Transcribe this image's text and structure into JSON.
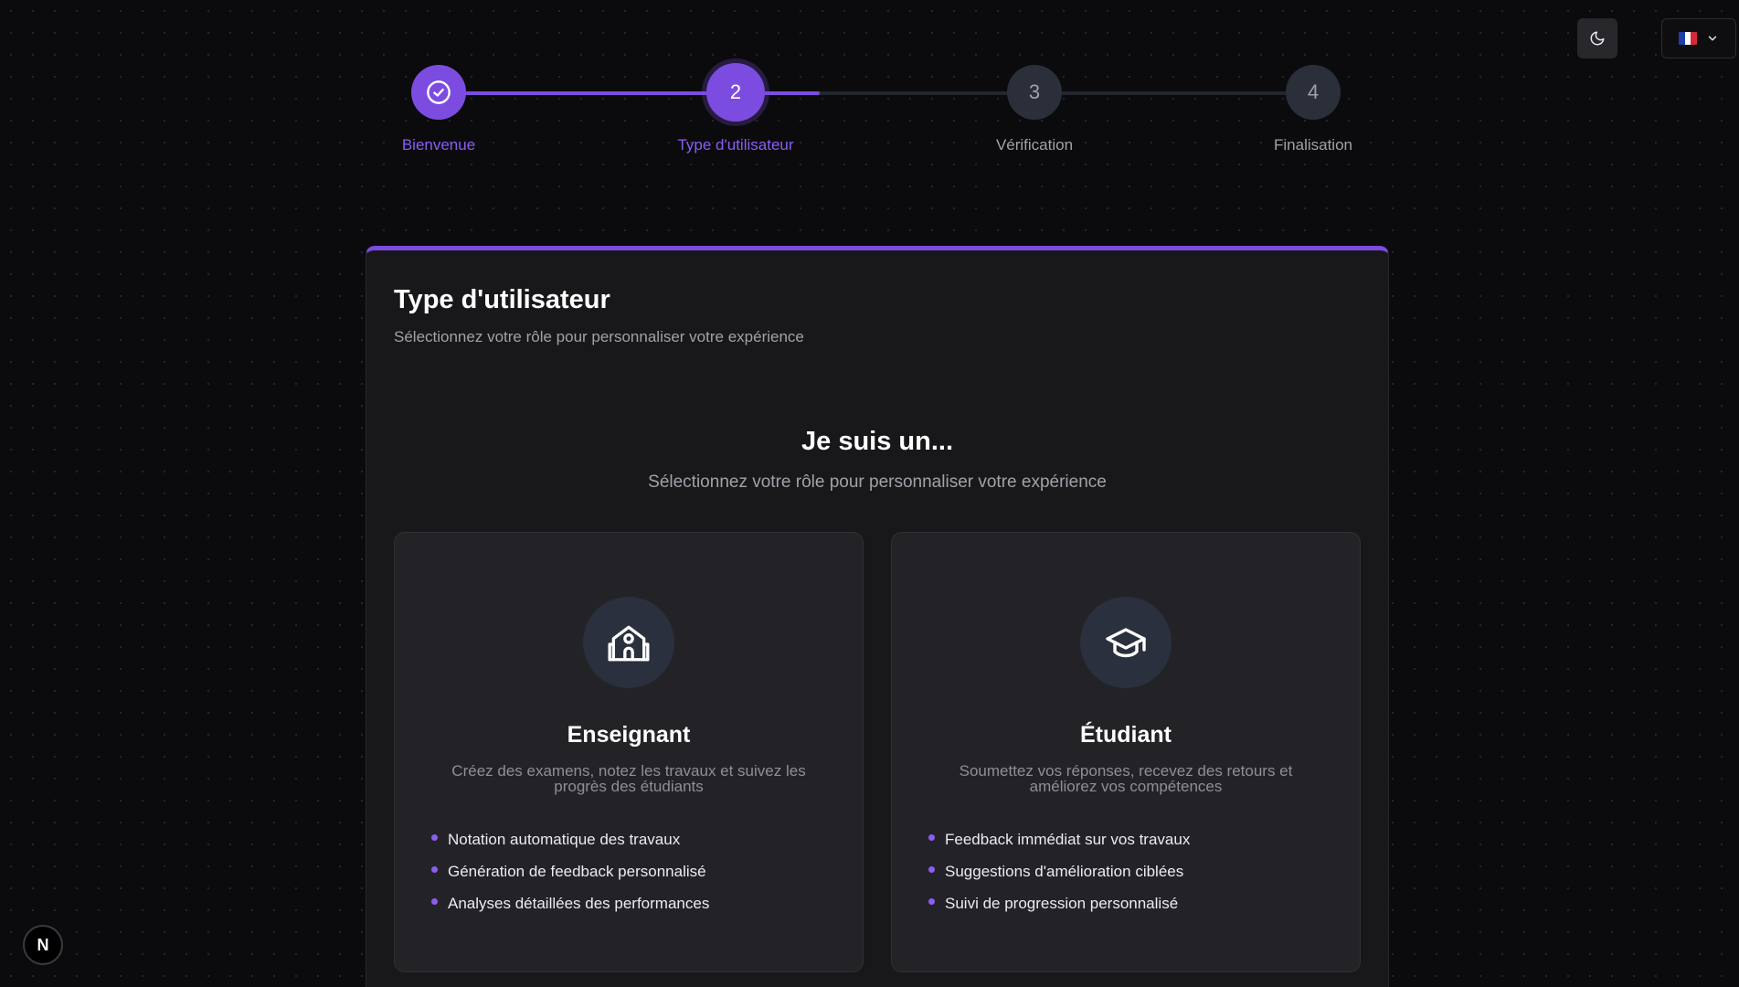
{
  "colors": {
    "accent": "#7c4ce0",
    "accent_text": "#8b5cf6",
    "inactive_step": "#2a2f3a",
    "card_bg": "#18181b"
  },
  "header": {
    "theme_toggle_icon": "moon-icon",
    "language": {
      "flag": "flag-fr-icon",
      "dropdown_icon": "chevron-down-icon"
    }
  },
  "stepper": {
    "steps": [
      {
        "label": "Bienvenue",
        "number": "",
        "state": "completed",
        "icon": "check-circle-icon"
      },
      {
        "label": "Type d'utilisateur",
        "number": "2",
        "state": "active"
      },
      {
        "label": "Vérification",
        "number": "3",
        "state": "upcoming"
      },
      {
        "label": "Finalisation",
        "number": "4",
        "state": "upcoming"
      }
    ]
  },
  "card": {
    "title": "Type d'utilisateur",
    "subtitle": "Sélectionnez votre rôle pour personnaliser votre expérience",
    "section_title": "Je suis un...",
    "section_subtitle": "Sélectionnez votre rôle pour personnaliser votre expérience",
    "roles": [
      {
        "icon": "school-icon",
        "name": "Enseignant",
        "description": "Créez des examens, notez les travaux et suivez les progrès des étudiants",
        "features": [
          "Notation automatique des travaux",
          "Génération de feedback personnalisé",
          "Analyses détaillées des performances"
        ]
      },
      {
        "icon": "graduation-cap-icon",
        "name": "Étudiant",
        "description": "Soumettez vos réponses, recevez des retours et améliorez vos compétences",
        "features": [
          "Feedback immédiat sur vos travaux",
          "Suggestions d'amélioration ciblées",
          "Suivi de progression personnalisé"
        ]
      }
    ]
  },
  "dev_badge": {
    "label": "N"
  }
}
